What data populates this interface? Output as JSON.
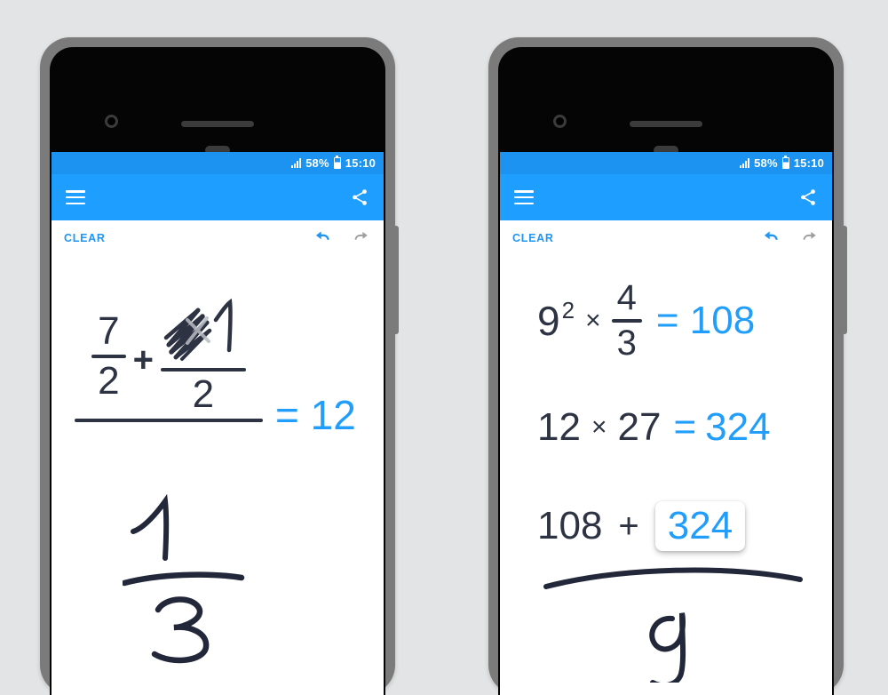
{
  "background_color": "#e3e4e5",
  "accent_color": "#1e9eff",
  "status_bar": {
    "battery_percent": "58%",
    "time": "15:10",
    "signal_icon": "signal-bars-icon",
    "battery_icon": "battery-icon"
  },
  "app_bar": {
    "menu_icon": "hamburger-menu-icon",
    "share_icon": "share-icon"
  },
  "action_bar": {
    "clear_label": "CLEAR",
    "undo_icon": "undo-arrow-icon",
    "redo_icon": "redo-arrow-icon",
    "undo_enabled": true,
    "redo_enabled": false
  },
  "phones": [
    {
      "id": "phone-left",
      "expression": {
        "description": "complex fraction with scribbled-out numerator",
        "numerator_left_fraction": {
          "num": "7",
          "den": "2"
        },
        "operator": "+",
        "numerator_right_fraction": {
          "num": "1",
          "den": "2",
          "num_scribbled": true
        },
        "denominator_handwritten": {
          "num": "1",
          "den": "3"
        },
        "equals": "=",
        "result": "12"
      }
    },
    {
      "id": "phone-right",
      "lines": [
        {
          "base": "9",
          "exponent": "2",
          "times": "×",
          "fraction": {
            "num": "4",
            "den": "3"
          },
          "equals": "=",
          "result": "108"
        },
        {
          "left": "12",
          "times": "×",
          "right": "27",
          "equals": "=",
          "result": "324"
        },
        {
          "left": "108",
          "operator": "+",
          "chip_value": "324",
          "chip_highlighted": true,
          "denominator_handwritten": "9"
        }
      ]
    }
  ]
}
